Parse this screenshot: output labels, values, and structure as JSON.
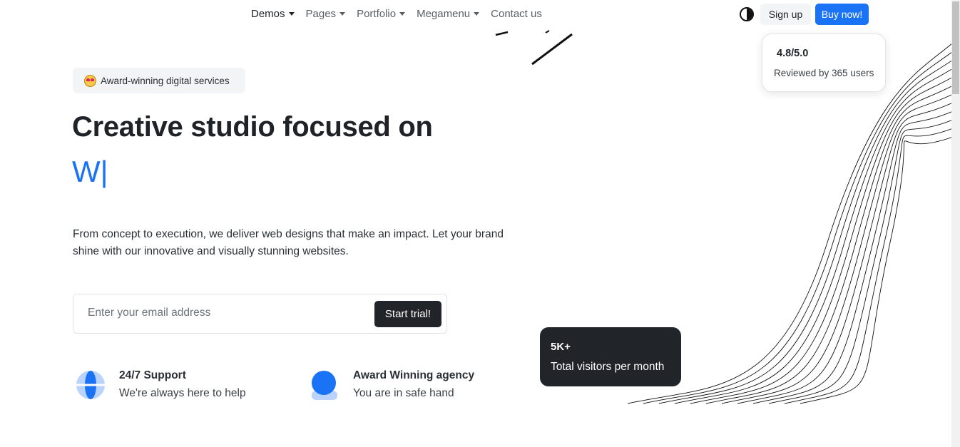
{
  "nav": {
    "items": [
      {
        "label": "Demos",
        "dropdown": true
      },
      {
        "label": "Pages",
        "dropdown": true
      },
      {
        "label": "Portfolio",
        "dropdown": true
      },
      {
        "label": "Megamenu",
        "dropdown": true
      },
      {
        "label": "Contact us",
        "dropdown": false
      }
    ],
    "signup_label": "Sign up",
    "buy_label": "Buy now!"
  },
  "hero": {
    "badge_text": "Award-winning digital services",
    "headline": "Creative studio focused on",
    "typed_text": "W|",
    "lead": "From concept to execution, we deliver web designs that make an impact. Let your brand shine with our innovative and visually stunning websites.",
    "email_placeholder": "Enter your email address",
    "cta_label": "Start trial!"
  },
  "features": [
    {
      "title": "24/7 Support",
      "desc": "We're always here to help",
      "icon": "globe-icon"
    },
    {
      "title": "Award Winning agency",
      "desc": "You are in safe hand",
      "icon": "user-icon"
    }
  ],
  "rating": {
    "score": "4.8/5.0",
    "sub": "Reviewed by 365 users"
  },
  "visitors": {
    "number": "5K+",
    "label": "Total visitors per month"
  },
  "colors": {
    "primary": "#1a73f5",
    "dark": "#212529",
    "muted": "#f3f4f5"
  }
}
